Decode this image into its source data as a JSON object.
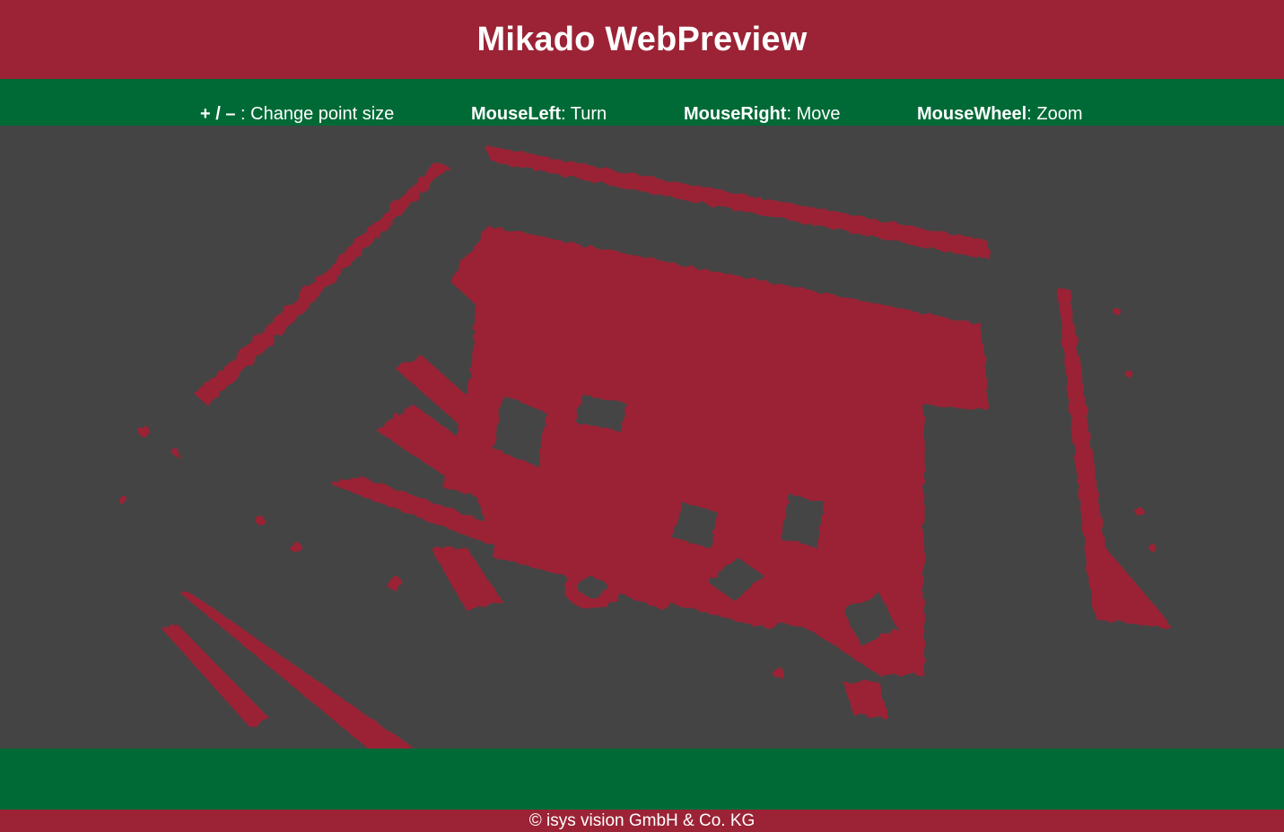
{
  "app": {
    "title": "Mikado WebPreview"
  },
  "help": [
    {
      "key": "+ / –",
      "sep": " : ",
      "action": "Change point size"
    },
    {
      "key": "MouseLeft",
      "sep": ": ",
      "action": "Turn"
    },
    {
      "key": "MouseRight",
      "sep": ": ",
      "action": "Move"
    },
    {
      "key": "MouseWheel",
      "sep": ": ",
      "action": "Zoom"
    }
  ],
  "footer": {
    "copyright": "© isys vision GmbH & Co. KG"
  },
  "colors": {
    "brand_red": "#9b2335",
    "brand_green": "#006a36",
    "viewer_bg": "#444444",
    "point_color": "#9b2335"
  }
}
